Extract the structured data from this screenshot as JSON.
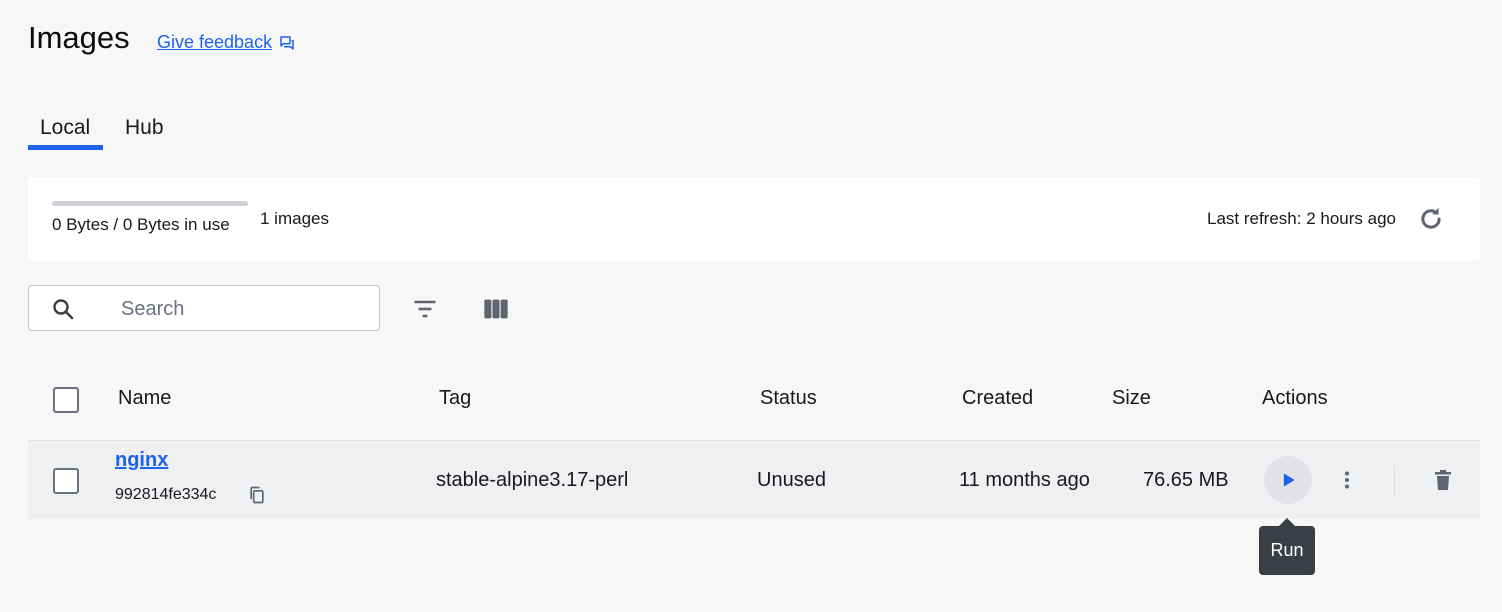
{
  "header": {
    "title": "Images",
    "feedback_label": "Give feedback",
    "feedback_icon": "feedback-icon"
  },
  "tabs": [
    {
      "label": "Local",
      "active": true
    },
    {
      "label": "Hub",
      "active": false
    }
  ],
  "usage": {
    "text": "0 Bytes / 0 Bytes in use",
    "fill_fraction": 0,
    "images_count": "1 images",
    "last_refresh": "Last refresh: 2 hours ago",
    "refresh_icon": "refresh-icon"
  },
  "toolbar": {
    "search_placeholder": "Search",
    "search_value": "",
    "filter_icon": "filter-icon",
    "columns_icon": "columns-icon"
  },
  "table": {
    "columns": [
      "Name",
      "Tag",
      "Status",
      "Created",
      "Size",
      "Actions"
    ],
    "rows": [
      {
        "name": "nginx",
        "id": "992814fe334c",
        "tag": "stable-alpine3.17-perl",
        "status": "Unused",
        "created": "11 months ago",
        "size": "76.65 MB"
      }
    ]
  },
  "tooltip": {
    "text": "Run"
  },
  "colors": {
    "accent": "#1d63ed",
    "background": "#f7f7f8",
    "tooltip_bg": "#3b3e45"
  }
}
